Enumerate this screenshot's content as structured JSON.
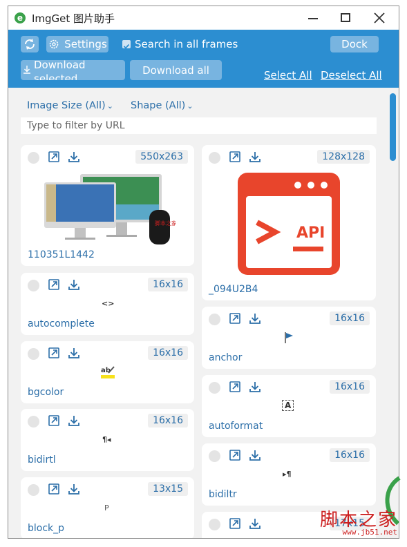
{
  "window": {
    "title": "ImgGet 图片助手",
    "controls": [
      "minimize-icon",
      "maximize-icon",
      "close-icon"
    ]
  },
  "toolbar": {
    "settings_label": "Settings",
    "search_frames_label": "Search in all frames",
    "search_frames_checked": true,
    "dock_label": "Dock",
    "download_selected_label": "Download selected",
    "download_all_label": "Download all",
    "select_all_label": "Select All",
    "deselect_all_label": "Deselect All"
  },
  "filters": {
    "image_size_label": "Image Size (All)",
    "shape_label": "Shape (All)",
    "url_placeholder": "Type to filter by URL"
  },
  "images": {
    "left": [
      {
        "name": "110351L1442",
        "size": "550x263",
        "thumb": "desktop-computer-image"
      },
      {
        "name": "autocomplete",
        "size": "16x16",
        "thumb_text": "<>"
      },
      {
        "name": "bgcolor",
        "size": "16x16",
        "thumb": "bgcolor-icon"
      },
      {
        "name": "bidirtl",
        "size": "16x16",
        "thumb_text": "¶◂"
      },
      {
        "name": "block_p",
        "size": "13x15",
        "thumb_text": "P"
      }
    ],
    "right": [
      {
        "name": "_094U2B4",
        "size": "128x128",
        "thumb": "api-window-icon",
        "thumb_text": "API"
      },
      {
        "name": "anchor",
        "size": "16x16",
        "thumb": "flag-icon"
      },
      {
        "name": "autoformat",
        "size": "16x16",
        "thumb_text": "A"
      },
      {
        "name": "bidiltr",
        "size": "16x16",
        "thumb_text": "▸¶"
      },
      {
        "name": "",
        "size": "17x15",
        "thumb": ""
      }
    ]
  },
  "watermark": {
    "text": "脚本之家",
    "url": "www.jb51.net"
  },
  "colors": {
    "accent": "#2c8ed1",
    "link": "#2b6ea8",
    "api_red": "#e8452c"
  }
}
